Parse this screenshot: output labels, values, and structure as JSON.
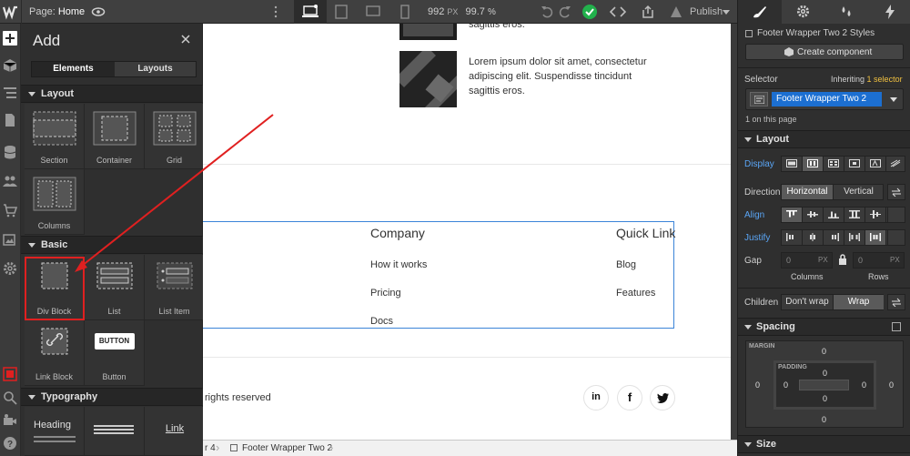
{
  "topbar": {
    "page_label": "Page:",
    "page_name": "Home",
    "width_value": "992",
    "width_unit": "PX",
    "zoom_value": "99.7",
    "zoom_unit": "%",
    "publish_label": "Publish"
  },
  "add_panel": {
    "title": "Add",
    "tabs": [
      "Elements",
      "Layouts"
    ],
    "sections": {
      "layout": "Layout",
      "basic": "Basic",
      "typography": "Typography"
    },
    "layout_items": [
      "Section",
      "Container",
      "Grid",
      "Columns"
    ],
    "basic_items": [
      "Div Block",
      "List",
      "List Item",
      "Link Block",
      "Button"
    ],
    "button_preview": "BUTTON",
    "typography_items": [
      "Heading",
      "Link"
    ]
  },
  "canvas": {
    "card_text_top": "sagittis eros.",
    "card_text": "Lorem ipsum dolor sit amet, consectetur adipiscing elit. Suspendisse tincidunt sagittis eros.",
    "footer": {
      "company_heading": "Company",
      "company_links": [
        "How it works",
        "Pricing",
        "Docs"
      ],
      "quick_heading": "Quick Link",
      "quick_links": [
        "Blog",
        "Features"
      ],
      "rights": "rights reserved"
    },
    "social_icons": [
      "linkedin-icon",
      "facebook-icon",
      "twitter-icon"
    ]
  },
  "breadcrumb": {
    "prev": "r 4",
    "current": "Footer Wrapper Two 2"
  },
  "right_panel": {
    "styles_label": "Footer Wrapper Two 2 Styles",
    "create_component": "Create component",
    "selector_label": "Selector",
    "inheriting_label": "Inheriting",
    "inheriting_count": "1 selector",
    "selector_value": "Footer Wrapper Two 2",
    "on_page": "1 on this page",
    "layout_section": "Layout",
    "display_label": "Display",
    "direction_label": "Direction",
    "direction_options": [
      "Horizontal",
      "Vertical"
    ],
    "align_label": "Align",
    "justify_label": "Justify",
    "gap_label": "Gap",
    "gap_columns_value": "0",
    "gap_rows_value": "0",
    "gap_unit": "PX",
    "columns_label": "Columns",
    "rows_label": "Rows",
    "children_label": "Children",
    "children_options": [
      "Don't wrap",
      "Wrap"
    ],
    "spacing_section": "Spacing",
    "margin_label": "MARGIN",
    "padding_label": "PADDING",
    "margin_values": {
      "top": "0",
      "right": "0",
      "bottom": "0",
      "left": "0"
    },
    "padding_values": {
      "top": "0",
      "right": "0",
      "bottom": "0",
      "left": "0"
    },
    "size_section": "Size"
  },
  "colors": {
    "accent_blue": "#1a73e8",
    "selector_blue": "#1c6fd1",
    "highlight_red": "#e02020",
    "green_check": "#22b14c"
  }
}
